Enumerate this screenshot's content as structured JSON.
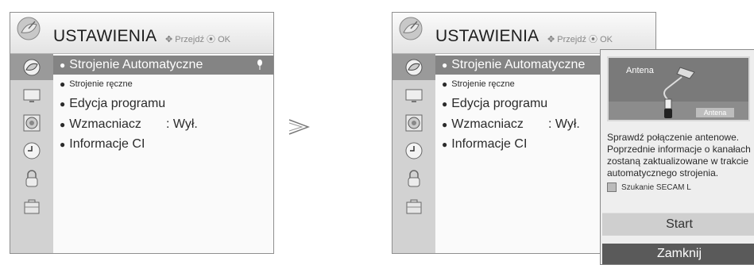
{
  "screens": [
    {
      "header": {
        "title": "USTAWIENIA",
        "hint_nav": "Przejdź",
        "hint_ok": "OK"
      },
      "items": [
        {
          "label": "Strojenie Automatyczne",
          "value": ""
        },
        {
          "label": "Strojenie ręczne",
          "value": ""
        },
        {
          "label": "Edycja programu",
          "value": ""
        },
        {
          "label": "Wzmacniacz",
          "value": ": Wył."
        },
        {
          "label": "Informacje CI",
          "value": ""
        }
      ],
      "selected_index": 0
    },
    {
      "header": {
        "title": "USTAWIENIA",
        "hint_nav": "Przejdź",
        "hint_ok": "OK"
      },
      "items": [
        {
          "label": "Strojenie Automatyczne",
          "value": ""
        },
        {
          "label": "Strojenie ręczne",
          "value": ""
        },
        {
          "label": "Edycja programu",
          "value": ""
        },
        {
          "label": "Wzmacniacz",
          "value": ": Wył."
        },
        {
          "label": "Informacje CI",
          "value": ""
        }
      ],
      "selected_index": 0
    }
  ],
  "sidebar_icons": [
    "satellite-icon",
    "tv-screen-icon",
    "speaker-icon",
    "clock-icon",
    "lock-icon",
    "toolbox-icon"
  ],
  "popup": {
    "antenna_label": "Antena",
    "antenna_tag": "Antena",
    "message": "Sprawdź połączenie antenowe. Poprzednie informacje o kanałach zostaną zaktualizowane w trakcie automatycznego strojenia.",
    "secam_label": "Szukanie SECAM L",
    "secam_checked": false,
    "start_label": "Start",
    "close_label": "Zamknij"
  },
  "colors": {
    "selected": "#848484",
    "sidebar": "#d2d2d2",
    "close_button": "#5a5a5a"
  }
}
